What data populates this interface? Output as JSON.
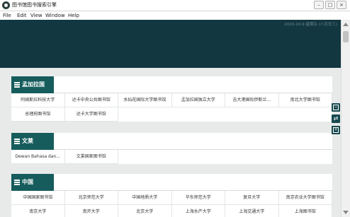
{
  "window": {
    "title": "图书馆图书搜索引擎"
  },
  "menu": [
    "File",
    "Edit",
    "View",
    "Window",
    "Help"
  ],
  "header": {
    "datetime": "2020-10-9 星期五 (八月廿三)"
  },
  "sections": [
    {
      "name": "孟加拉国",
      "items": [
        "阿姆斯拉科技大学",
        "达卡中央公共图书馆",
        "水仙花国际大学图书馆",
        "孟加拉国独立大学",
        "吉大港国际伊斯兰...",
        "南北大学图书馆",
        "总理府图书馆",
        "达卡大学图书馆"
      ]
    },
    {
      "name": "文莱",
      "items": [
        "Dewan Bahasa dan...",
        "文莱国家图书馆"
      ]
    },
    {
      "name": "中国",
      "items": [
        "中国国家图书馆",
        "北京师范大学",
        "中国地质大学",
        "华东师范大学",
        "复旦大学",
        "南京农业大学图书馆",
        "南京大学",
        "南开大学",
        "北京大学",
        "上海水产大学",
        "上海交通大学",
        "上海图书馆"
      ]
    }
  ],
  "side_buttons": [
    "collapse-icon",
    "shuffle-icon",
    "expand-icon"
  ]
}
